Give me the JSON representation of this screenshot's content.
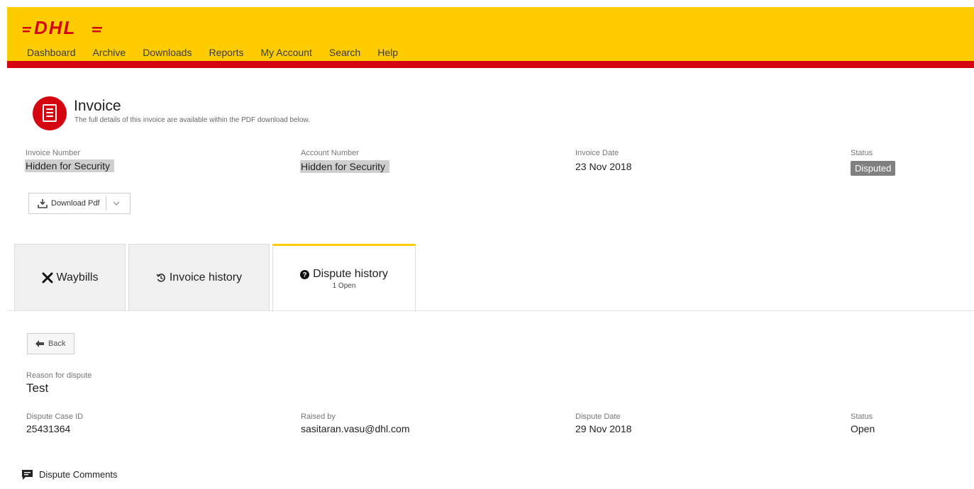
{
  "header": {
    "logo_text": "DHL",
    "brand_color": "#ffcc00",
    "accent_color": "#d40511",
    "nav": [
      "Dashboard",
      "Archive",
      "Downloads",
      "Reports",
      "My Account",
      "Search",
      "Help"
    ]
  },
  "invoice": {
    "title": "Invoice",
    "subtitle": "The full details of this invoice are available within the PDF download below.",
    "icon": "document-icon",
    "invoice_number_label": "Invoice Number",
    "invoice_number_value": "Hidden for Security",
    "account_number_label": "Account Number",
    "account_number_value": "Hidden for Security",
    "invoice_date_label": "Invoice Date",
    "invoice_date_value": "23 Nov 2018",
    "status_label": "Status",
    "status_value": "Disputed",
    "download_label": "Download Pdf"
  },
  "tabs": [
    {
      "label": "Waybills",
      "icon": "plane-icon",
      "sub": ""
    },
    {
      "label": "Invoice history",
      "icon": "history-icon",
      "sub": ""
    },
    {
      "label": "Dispute history",
      "icon": "question-circle-icon",
      "sub": "1 Open"
    }
  ],
  "dispute": {
    "back_label": "Back",
    "reason_label": "Reason for dispute",
    "reason_value": "Test",
    "case_id_label": "Dispute Case ID",
    "case_id_value": "25431364",
    "raised_by_label": "Raised by",
    "raised_by_value": "sasitaran.vasu@dhl.com",
    "dispute_date_label": "Dispute Date",
    "dispute_date_value": "29 Nov 2018",
    "status_label": "Status",
    "status_value": "Open",
    "comments_label": "Dispute Comments"
  }
}
